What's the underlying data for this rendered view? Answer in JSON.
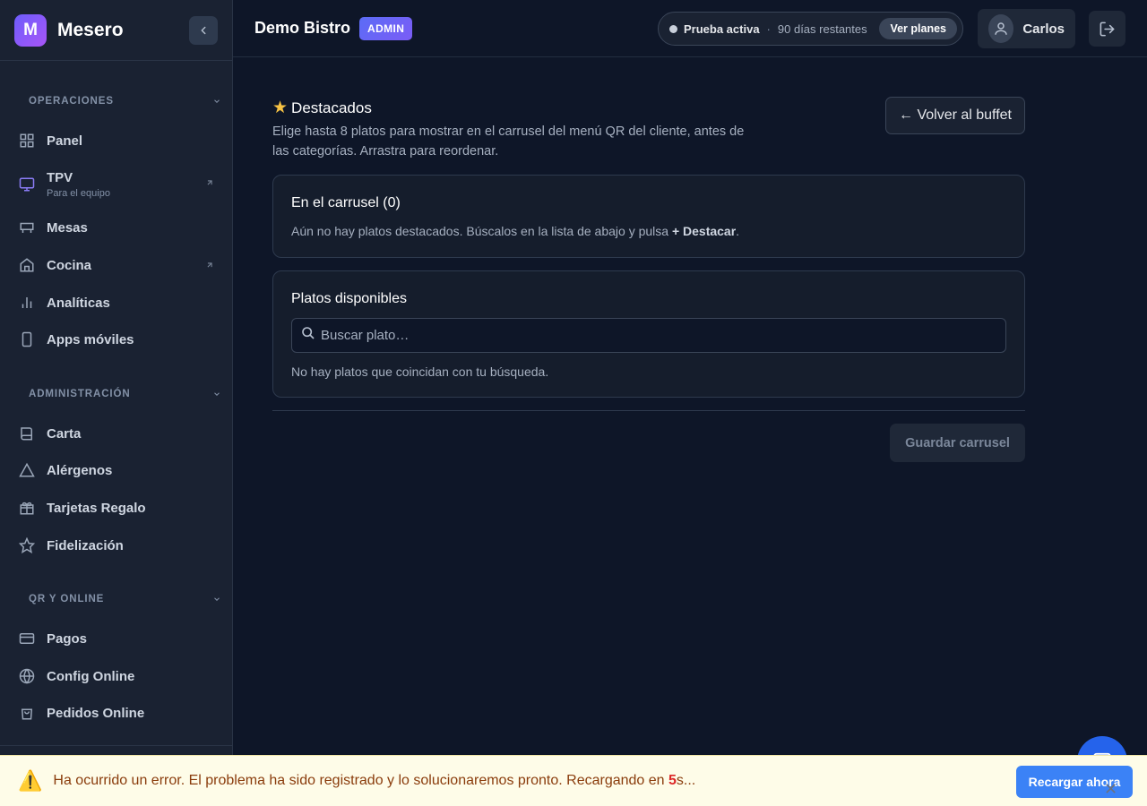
{
  "brand": {
    "initial": "M",
    "name": "Mesero"
  },
  "sidebar": {
    "sections": [
      {
        "title": "OPERACIONES",
        "items": [
          {
            "label": "Panel",
            "icon": "grid-icon"
          },
          {
            "label": "TPV",
            "sublabel": "Para el equipo",
            "icon": "monitor-icon",
            "external": true
          },
          {
            "label": "Mesas",
            "icon": "table-icon"
          },
          {
            "label": "Cocina",
            "icon": "home-icon",
            "external": true
          },
          {
            "label": "Analíticas",
            "icon": "bar-chart-icon"
          },
          {
            "label": "Apps móviles",
            "icon": "smartphone-icon"
          }
        ]
      },
      {
        "title": "ADMINISTRACIÓN",
        "items": [
          {
            "label": "Carta",
            "icon": "book-icon"
          },
          {
            "label": "Alérgenos",
            "icon": "warning-icon"
          },
          {
            "label": "Tarjetas Regalo",
            "icon": "gift-icon"
          },
          {
            "label": "Fidelización",
            "icon": "star-icon"
          }
        ]
      },
      {
        "title": "QR Y ONLINE",
        "items": [
          {
            "label": "Pagos",
            "icon": "credit-card-icon"
          },
          {
            "label": "Config Online",
            "icon": "globe-icon"
          },
          {
            "label": "Pedidos Online",
            "icon": "shopping-bag-icon"
          }
        ]
      }
    ]
  },
  "header": {
    "restaurant": "Demo Bistro",
    "role_badge": "ADMIN",
    "trial_status": "Prueba activa",
    "trial_separator": "·",
    "trial_remaining": "90 días restantes",
    "plans_button": "Ver planes",
    "user_name": "Carlos"
  },
  "main": {
    "title": "Destacados",
    "description": "Elige hasta 8 platos para mostrar en el carrusel del menú QR del cliente, antes de las categorías. Arrastra para reordenar.",
    "back_button": "← Volver al buffet",
    "carousel": {
      "title": "En el carrusel (0)",
      "empty_text": "Aún no hay platos destacados. Búscalos en la lista de abajo y pulsa ",
      "empty_action": "+ Destacar",
      "empty_end": "."
    },
    "available": {
      "title": "Platos disponibles",
      "search_placeholder": "Buscar plato…",
      "no_results": "No hay platos que coincidan con tu búsqueda."
    },
    "save_button": "Guardar carrusel"
  },
  "error_banner": {
    "message_start": "Ha ocurrido un error. El problema ha sido registrado y lo solucionaremos pronto. Recargando en ",
    "countdown": "5",
    "message_end": "s...",
    "reload_button": "Recargar ahora"
  },
  "colors": {
    "accent": "#6d5dfc",
    "primary_button": "#3b82f6",
    "warning_bg": "#fefce8",
    "warning_text": "#8a3c0c"
  }
}
